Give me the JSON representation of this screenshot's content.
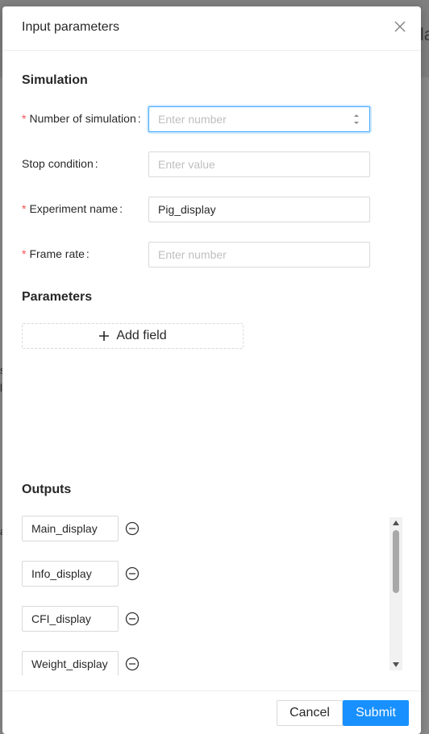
{
  "colors": {
    "primary": "#1890ff",
    "required": "#ff4d4f",
    "border": "#d9d9d9"
  },
  "background": {
    "title_fragment": "la",
    "marks": [
      "s",
      "l",
      "a"
    ]
  },
  "modal": {
    "title": "Input parameters",
    "close_icon": "close-icon"
  },
  "simulation": {
    "section_title": "Simulation",
    "fields": [
      {
        "label": "Number of simulation",
        "required": true,
        "value": "",
        "placeholder": "Enter number",
        "focused": true,
        "type": "number"
      },
      {
        "label": "Stop condition",
        "required": false,
        "value": "",
        "placeholder": "Enter value"
      },
      {
        "label": "Experiment name",
        "required": true,
        "value": "Pig_display",
        "placeholder": ""
      },
      {
        "label": "Frame rate",
        "required": true,
        "value": "",
        "placeholder": "Enter number"
      }
    ]
  },
  "parameters": {
    "section_title": "Parameters",
    "add_field_label": "Add field"
  },
  "outputs": {
    "section_title": "Outputs",
    "items": [
      "Main_display",
      "Info_display",
      "CFI_display",
      "Weight_display"
    ]
  },
  "footer": {
    "cancel_label": "Cancel",
    "submit_label": "Submit"
  }
}
